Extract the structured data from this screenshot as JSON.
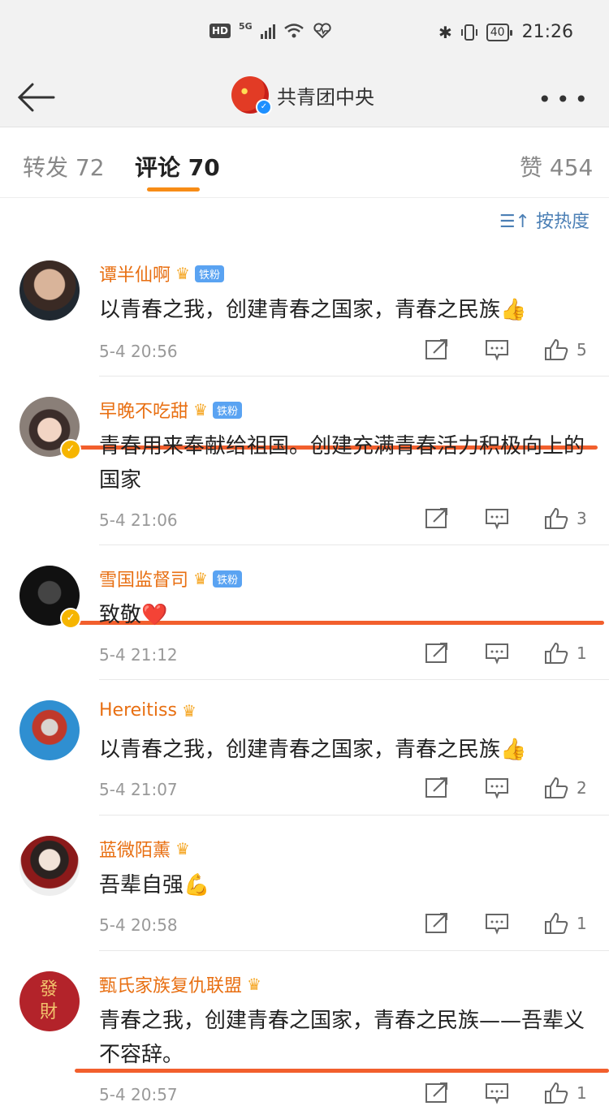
{
  "status": {
    "hd": "HD",
    "network": "5G",
    "battery": "40",
    "time": "21:26"
  },
  "header": {
    "title": "共青团中央"
  },
  "tabs": {
    "forward": "转发 72",
    "comments": "评论 70",
    "likes": "赞 454"
  },
  "sort_label": "按热度",
  "colors": {
    "accent": "#f78c16",
    "username": "#e86f12",
    "highlight": "#f25f2d",
    "link": "#4b7fb5"
  },
  "comments": [
    {
      "name": "谭半仙啊",
      "badge": "铁粉",
      "text": "以青春之我，创建青春之国家，青春之民族👍",
      "time": "5-4 20:56",
      "likes": "5"
    },
    {
      "name": "早晚不吃甜",
      "badge": "铁粉",
      "text": "青春用来奉献给祖国。创建充满青春活力积极向上的国家",
      "time": "5-4 21:06",
      "likes": "3"
    },
    {
      "name": "雪国监督司",
      "badge": "铁粉",
      "text": "致敬❤️",
      "time": "5-4 21:12",
      "likes": "1"
    },
    {
      "name": "Hereitiss",
      "badge": "",
      "text": "以青春之我，创建青春之国家，青春之民族👍",
      "time": "5-4 21:07",
      "likes": "2"
    },
    {
      "name": "蓝微陌薰",
      "badge": "",
      "text": "吾辈自强💪",
      "time": "5-4 20:58",
      "likes": "1"
    },
    {
      "name": "甄氏家族复仇联盟",
      "badge": "",
      "avatar_text": "發財",
      "text": "青春之我，创建青春之国家，青春之民族——吾辈义不容辞。",
      "time": "5-4 20:57",
      "likes": "1"
    }
  ]
}
